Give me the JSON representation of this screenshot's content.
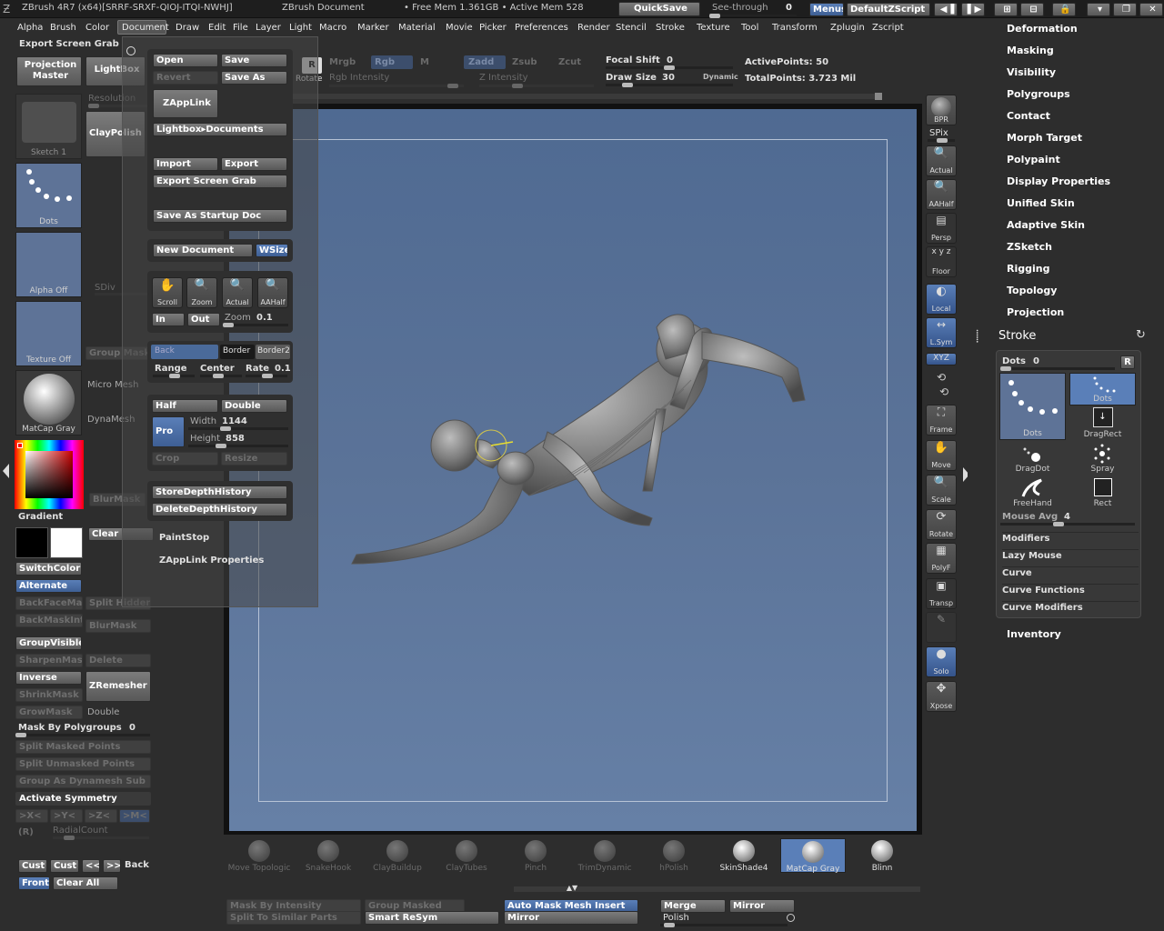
{
  "titlebar": {
    "app": "ZBrush 4R7 (x64)[SRRF-SRXF-QIOJ-ITQI-NWHJ]",
    "doc": "ZBrush Document",
    "mem": "• Free Mem 1.361GB • Active Mem 528",
    "quicksave": "QuickSave",
    "seethrough": "See-through",
    "seethrough_val": "0",
    "menus": "Menus",
    "script": "DefaultZScript"
  },
  "menubar": [
    "Alpha",
    "Brush",
    "Color",
    "Document",
    "Draw",
    "Edit",
    "File",
    "Layer",
    "Light",
    "Macro",
    "Marker",
    "Material",
    "Movie",
    "Picker",
    "Preferences",
    "Render",
    "Stencil",
    "Stroke",
    "Texture",
    "Tool",
    "Transform",
    "Zplugin",
    "Zscript"
  ],
  "topbar": {
    "export_screen_grab": "Export Screen Grab",
    "projection_master": "Projection Master",
    "lightbox": "LightBox",
    "rotate": "Rotate",
    "mrgb": "Mrgb",
    "rgb": "Rgb",
    "m": "M",
    "zadd": "Zadd",
    "zsub": "Zsub",
    "zcut": "Zcut",
    "rgb_intensity": "Rgb Intensity",
    "z_intensity": "Z Intensity",
    "focal_shift": "Focal Shift",
    "focal_shift_val": "0",
    "draw_size": "Draw Size",
    "draw_size_val": "30",
    "dynamic": "Dynamic",
    "active_points": "ActivePoints: 50",
    "total_points": "TotalPoints: 3.723 Mil"
  },
  "leftshelf": {
    "sketch": "Sketch 1",
    "resolution": "Resolution",
    "claypolish": "ClayPolish",
    "dots": "Dots",
    "alpha_off": "Alpha Off",
    "sdiv": "SDiv",
    "texture_off": "Texture Off",
    "group_mask": "Group Mask",
    "micro_mesh": "Micro Mesh",
    "dynamesh": "DynaMesh",
    "matcap_gray": "MatCap Gray",
    "blur_mask": "BlurMask",
    "gradient": "Gradient",
    "clear": "Clear",
    "switchcolor": "SwitchColor",
    "alternate": "Alternate",
    "backfacemask": "BackFaceMask",
    "split_hidden": "Split Hidden",
    "backmaskint": "BackMaskInt",
    "bluemask": "BlurMask",
    "groupvisible": "GroupVisible",
    "sharpenmask": "SharpenMask",
    "delete": "Delete",
    "inverse": "Inverse",
    "zremesher": "ZRemesher",
    "shrinkmask": "ShrinkMask",
    "growmask": "GrowMask",
    "double": "Double",
    "mask_by_polygroups": "Mask By Polygroups",
    "mask_by_polygroups_val": "0",
    "split_masked_points": "Split Masked Points",
    "split_unmasked_points": "Split Unmasked Points",
    "group_as_dynamesh_sub": "Group As Dynamesh Sub",
    "activate_symmetry": "Activate Symmetry",
    "sym_x": ">X<",
    "sym_y": ">Y<",
    "sym_z": ">Z<",
    "sym_m": ">M<",
    "sym_r": "(R)",
    "radialcount": "RadialCount",
    "cust1": "Cust",
    "cust2": "Cust",
    "prev": "<<",
    "next": ">>",
    "back": "Back",
    "front": "Front",
    "clear_all": "Clear All"
  },
  "docmenu": {
    "open": "Open",
    "save": "Save",
    "revert": "Revert",
    "save_as": "Save As",
    "zapplink": "ZAppLink",
    "lightbox_documents": "Lightbox▸Documents",
    "import": "Import",
    "export": "Export",
    "export_screen_grab": "Export Screen Grab",
    "save_as_startup": "Save As Startup Doc",
    "new_document": "New Document",
    "wsize": "WSize",
    "scroll": "Scroll",
    "zoom": "Zoom",
    "actual": "Actual",
    "aahalf": "AAHalf",
    "in": "In",
    "out": "Out",
    "zoom_label": "Zoom",
    "zoom_val": "0.1",
    "back": "Back",
    "border": "Border",
    "border2": "Border2",
    "range": "Range",
    "center": "Center",
    "rate": "Rate",
    "rate_val": "0.1",
    "half": "Half",
    "double": "Double",
    "pro": "Pro",
    "width_label": "Width",
    "width_val": "1144",
    "height_label": "Height",
    "height_val": "858",
    "crop": "Crop",
    "resize": "Resize",
    "store_depth": "StoreDepthHistory",
    "delete_depth": "DeleteDepthHistory",
    "paintstop": "PaintStop",
    "zapplink_props": "ZAppLink Properties"
  },
  "righttools": {
    "bpr": "BPR",
    "spix": "SPix",
    "actual": "Actual",
    "aahalf": "AAHalf",
    "persp": "Persp",
    "floor": "Floor",
    "local": "Local",
    "lsym": "L.Sym",
    "xyz": "XYZ",
    "frame": "Frame",
    "move": "Move",
    "scale": "Scale",
    "rotate": "Rotate",
    "polyf": "PolyF",
    "transp": "Transp",
    "solo": "Solo",
    "xpose": "Xpose"
  },
  "rightpanel": {
    "items_top": [
      "Deformation",
      "Masking",
      "Visibility",
      "Polygroups",
      "Contact",
      "Morph Target",
      "Polypaint",
      "Display Properties",
      "Unified Skin",
      "Adaptive Skin",
      "ZSketch",
      "Rigging",
      "Topology",
      "Projection"
    ],
    "stroke_title": "Stroke",
    "dots_label": "Dots",
    "dots_val": "0",
    "r": "R",
    "strokes": [
      "Dots",
      "Dots",
      "DragRect",
      "DragDot",
      "Spray",
      "FreeHand",
      "Rect"
    ],
    "mouse_avg": "Mouse Avg",
    "mouse_avg_val": "4",
    "sub_items": [
      "Modifiers",
      "Lazy Mouse",
      "Curve",
      "Curve Functions",
      "Curve Modifiers"
    ],
    "inventory": "Inventory"
  },
  "bottom": {
    "brushes": [
      "Move Topologic",
      "SnakeHook",
      "ClayBuildup",
      "ClayTubes",
      "Pinch",
      "TrimDynamic",
      "hPolish"
    ],
    "materials": [
      "SkinShade4",
      "MatCap Gray",
      "Blinn"
    ],
    "mask_by_intensity": "Mask By Intensity",
    "group_masked": "Group Masked",
    "split_to_similar": "Split To Similar Parts",
    "smart_resym": "Smart ReSym",
    "auto_mask": "Auto Mask Mesh Insert",
    "mirror": "Mirror",
    "merge": "Merge",
    "mirror2": "Mirror",
    "polish": "Polish"
  },
  "colors": {
    "canvas": "#5b7398",
    "accent": "#5a7fb8",
    "panel": "#3a3a3a"
  }
}
